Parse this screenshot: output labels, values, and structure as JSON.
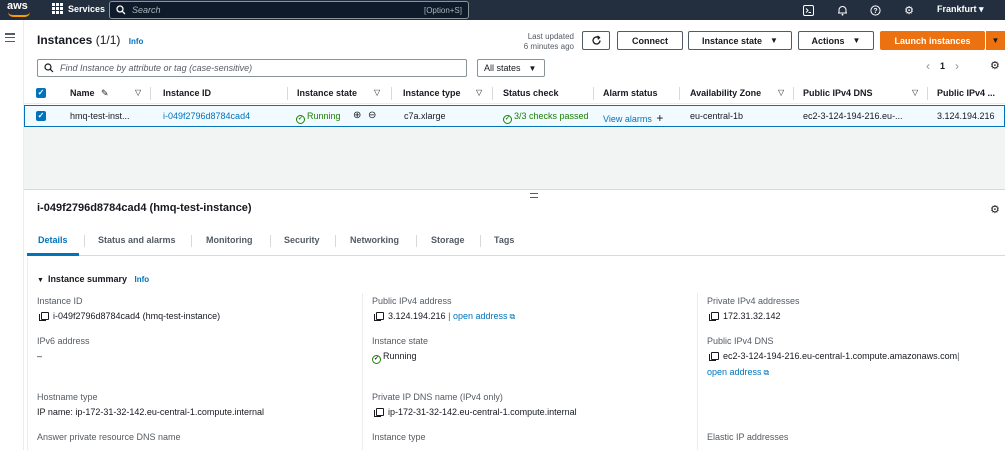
{
  "nav": {
    "logo": "aws",
    "services_label": "Services",
    "search_placeholder": "Search",
    "search_shortcut": "[Option+S]",
    "region": "Frankfurt ▾"
  },
  "header": {
    "title": "Instances",
    "count": "(1/1)",
    "info": "Info",
    "last_updated_line1": "Last updated",
    "last_updated_line2": "6 minutes ago",
    "connect_label": "Connect",
    "instance_state_label": "Instance state",
    "actions_label": "Actions",
    "launch_label": "Launch instances"
  },
  "filter": {
    "placeholder": "Find Instance by attribute or tag (case-sensitive)",
    "states_value": "All states",
    "page": "1"
  },
  "table": {
    "columns": [
      "Name",
      "Instance ID",
      "Instance state",
      "Instance type",
      "Status check",
      "Alarm status",
      "Availability Zone",
      "Public IPv4 DNS",
      "Public IPv4 ..."
    ],
    "row": {
      "name": "hmq-test-inst...",
      "instance_id": "i-049f2796d8784cad4",
      "state": "Running",
      "type": "c7a.xlarge",
      "status_check": "3/3 checks passed",
      "alarm": "View alarms",
      "az": "eu-central-1b",
      "dns": "ec2-3-124-194-216.eu-...",
      "ipv4": "3.124.194.216"
    }
  },
  "details": {
    "title": "i-049f2796d8784cad4 (hmq-test-instance)",
    "tabs": [
      "Details",
      "Status and alarms",
      "Monitoring",
      "Security",
      "Networking",
      "Storage",
      "Tags"
    ],
    "summary_title": "Instance summary",
    "summary_info": "Info",
    "fields": {
      "instance_id_label": "Instance ID",
      "instance_id_value": "i-049f2796d8784cad4 (hmq-test-instance)",
      "ipv6_label": "IPv6 address",
      "ipv6_value": "–",
      "hostname_label": "Hostname type",
      "hostname_value": "IP name: ip-172-31-32-142.eu-central-1.compute.internal",
      "answer_dns_label": "Answer private resource DNS name",
      "public_ipv4_label": "Public IPv4 address",
      "public_ipv4_value": "3.124.194.216",
      "open_address": "open address",
      "instance_state_label": "Instance state",
      "instance_state_value": "Running",
      "private_dns_label": "Private IP DNS name (IPv4 only)",
      "private_dns_value": "ip-172-31-32-142.eu-central-1.compute.internal",
      "instance_type_label": "Instance type",
      "private_ipv4_label": "Private IPv4 addresses",
      "private_ipv4_value": "172.31.32.142",
      "public_dns_label": "Public IPv4 DNS",
      "public_dns_value": "ec2-3-124-194-216.eu-central-1.compute.amazonaws.com",
      "elastic_ip_label": "Elastic IP addresses"
    }
  },
  "colors": {
    "nav_bg": "#232f3e",
    "accent": "#ec7211",
    "link": "#0073bb",
    "success": "#1d8102"
  }
}
